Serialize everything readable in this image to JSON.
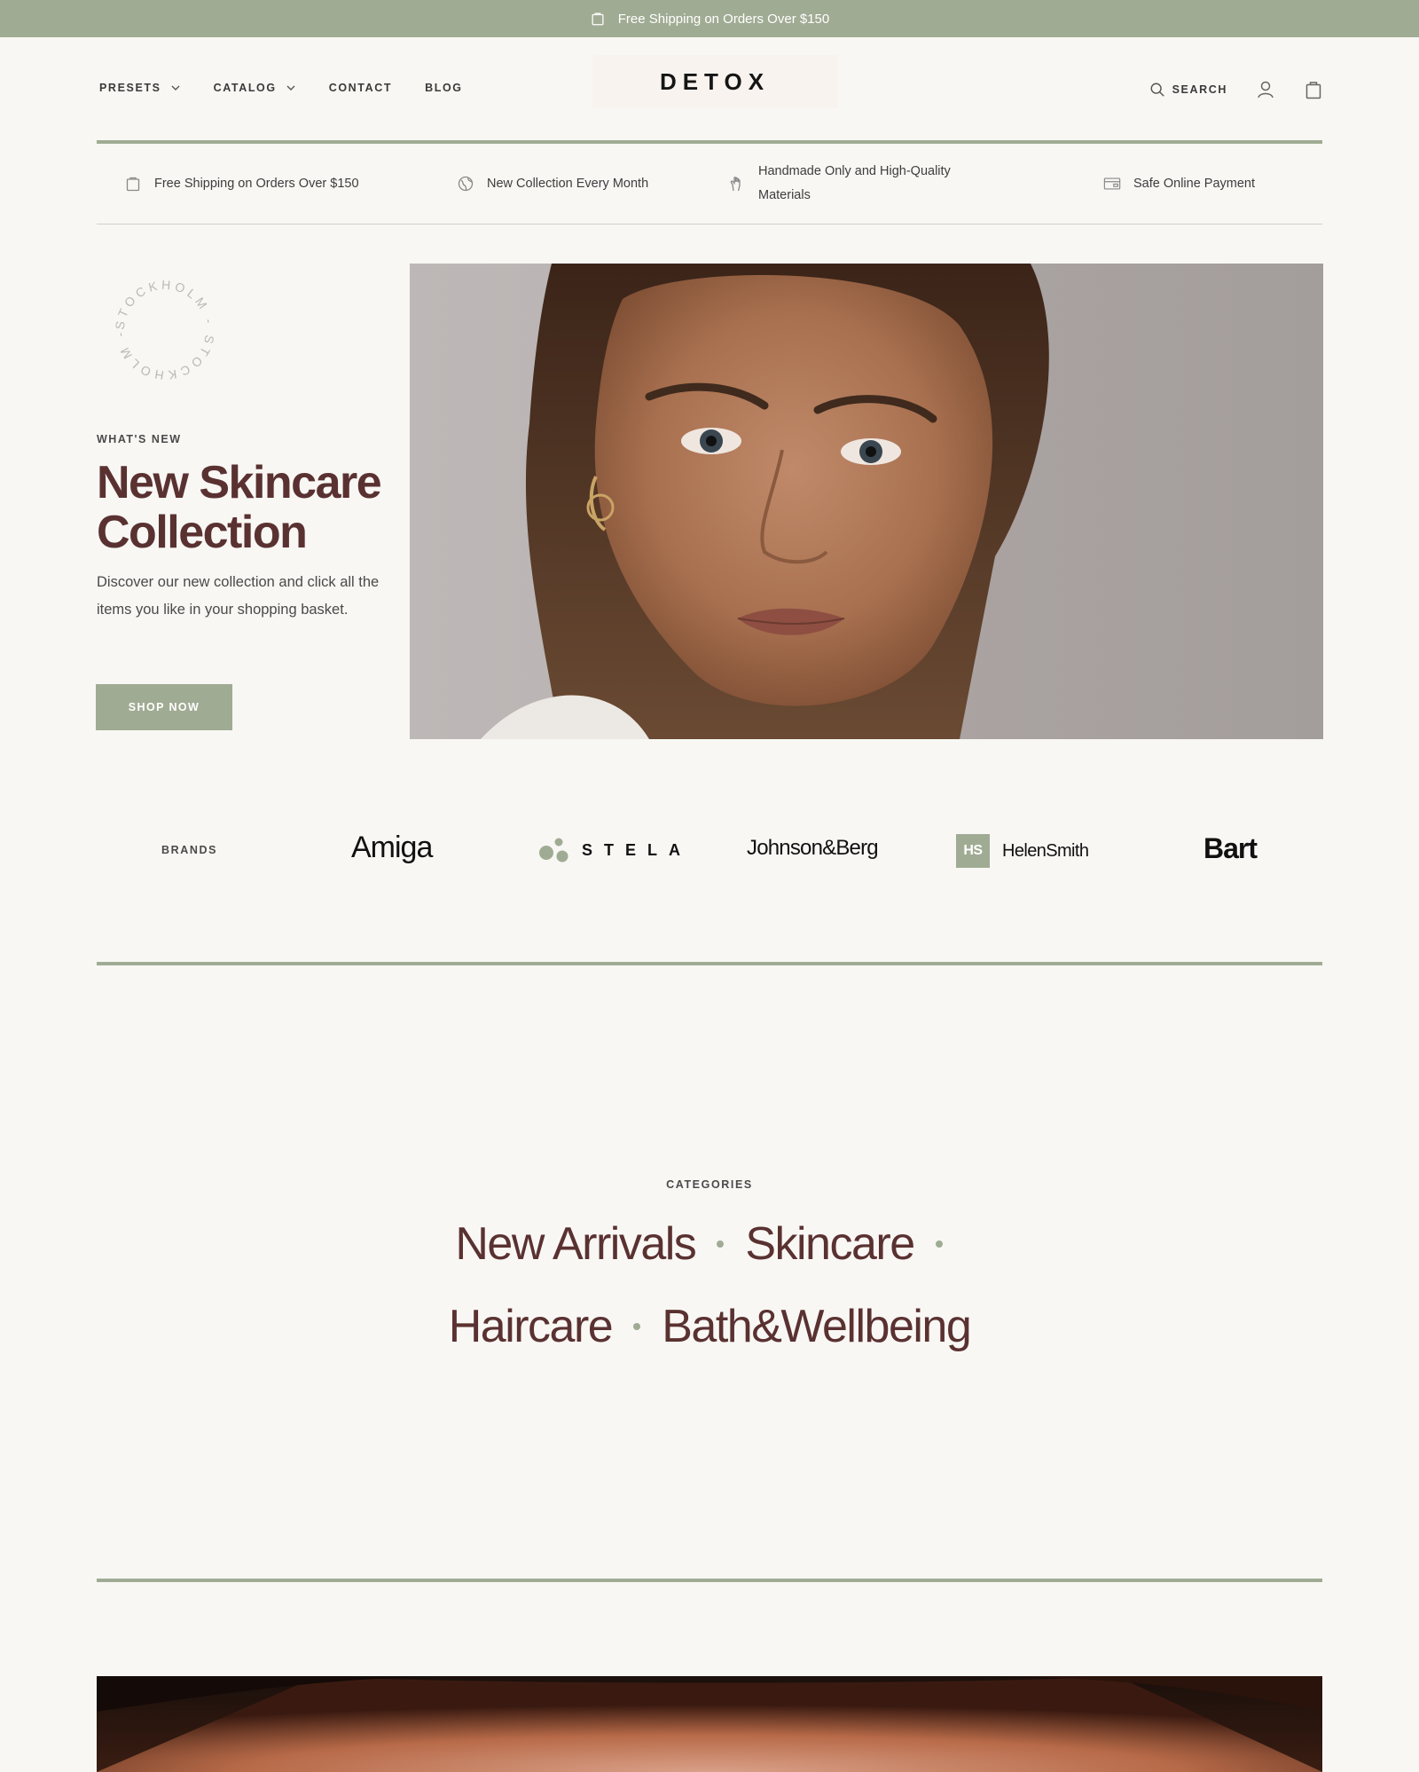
{
  "announcement": {
    "text": "Free Shipping on Orders Over $150",
    "icon": "bag-icon"
  },
  "header": {
    "nav": [
      {
        "label": "PRESETS",
        "has_dropdown": true
      },
      {
        "label": "CATALOG",
        "has_dropdown": true
      },
      {
        "label": "CONTACT",
        "has_dropdown": false
      },
      {
        "label": "BLOG",
        "has_dropdown": false
      }
    ],
    "logo": "DETOX",
    "search_label": "SEARCH",
    "icons": [
      "search-icon",
      "account-icon",
      "cart-icon"
    ]
  },
  "features": [
    {
      "text": "Free Shipping on Orders Over $150",
      "icon": "bag-icon"
    },
    {
      "text": "New Collection Every Month",
      "icon": "globe-icon"
    },
    {
      "text": "Handmade Only and High-Quality Materials",
      "icon": "hand-icon"
    },
    {
      "text": "Safe Online Payment",
      "icon": "card-icon"
    }
  ],
  "hero": {
    "stamp_text": "STOCKHOLM - STOCKHOLM -",
    "eyebrow": "WHAT'S NEW",
    "title": "New Skincare Collection",
    "text": "Discover our new collection and click all the items you like in your shopping basket.",
    "button": "SHOP NOW"
  },
  "brands": {
    "label": "BRANDS",
    "items": [
      "Amiga",
      "STELA",
      "Johnson&Berg",
      "HS",
      "HelenSmith",
      "Bart"
    ]
  },
  "categories": {
    "label": "CATEGORIES",
    "items": [
      "New Arrivals",
      "Skincare",
      "Haircare",
      "Bath&Wellbeing"
    ]
  },
  "colors": {
    "accent": "#a0ab93",
    "heading": "#5a3131",
    "background": "#f8f7f4"
  }
}
